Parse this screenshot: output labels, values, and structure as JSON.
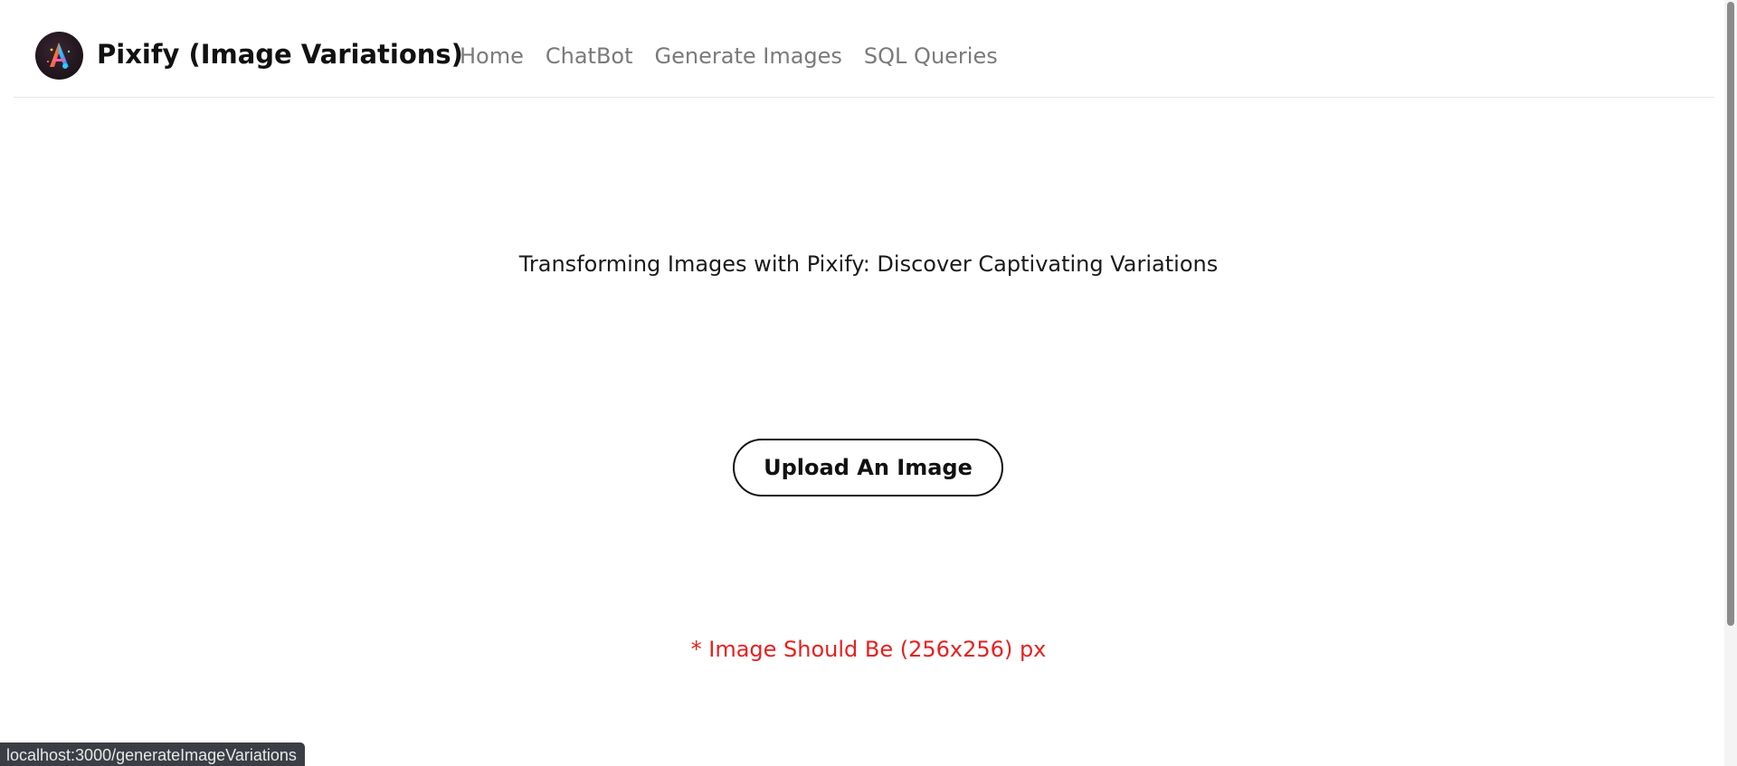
{
  "header": {
    "brand_title": "Pixify (Image Variations)",
    "logo_icon": "pixify-logo-icon",
    "nav_items": [
      {
        "label": "Home"
      },
      {
        "label": "ChatBot"
      },
      {
        "label": "Generate Images"
      },
      {
        "label": "SQL Queries"
      }
    ]
  },
  "main": {
    "headline": "Transforming Images with Pixify: Discover Captivating Variations",
    "upload_button_label": "Upload An Image",
    "size_note": "* Image Should Be (256x256) px"
  },
  "status_bar": {
    "url": "localhost:3000/generateImageVariations"
  },
  "colors": {
    "nav_link": "#7a7a7a",
    "warning": "#e8201f",
    "text": "#111111",
    "status_bar_bg": "#3b3f45"
  }
}
